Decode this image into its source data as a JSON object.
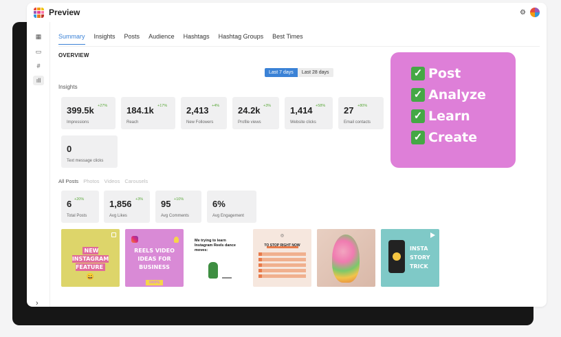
{
  "app": {
    "title": "Preview"
  },
  "tabs": [
    "Summary",
    "Insights",
    "Posts",
    "Audience",
    "Hashtags",
    "Hashtag Groups",
    "Best Times"
  ],
  "overview": {
    "heading": "OVERVIEW"
  },
  "date_range": {
    "active": "Last 7 days",
    "other": "Last 28 days"
  },
  "insights": {
    "heading": "Insights",
    "stats": [
      {
        "value": "399.5k",
        "change": "+27%",
        "label": "Impressions"
      },
      {
        "value": "184.1k",
        "change": "+17%",
        "label": "Reach"
      },
      {
        "value": "2,413",
        "change": "+4%",
        "label": "New Followers"
      },
      {
        "value": "24.2k",
        "change": "+3%",
        "label": "Profile views"
      },
      {
        "value": "1,414",
        "change": "+58%",
        "label": "Website clicks"
      },
      {
        "value": "27",
        "change": "+80%",
        "label": "Email contacts"
      },
      {
        "value": "0",
        "change": "",
        "label": "Text message clicks"
      }
    ]
  },
  "post_filters": [
    "All Posts",
    "Photos",
    "Videos",
    "Carousels"
  ],
  "post_stats": [
    {
      "value": "6",
      "change": "+20%",
      "label": "Total Posts"
    },
    {
      "value": "1,856",
      "change": "+3%",
      "label": "Avg Likes"
    },
    {
      "value": "95",
      "change": "+10%",
      "label": "Avg Comments"
    },
    {
      "value": "6%",
      "change": "",
      "label": "Avg Engagement"
    }
  ],
  "thumbnails": {
    "t1": {
      "text": "NEW INSTAGRAM FEATURE"
    },
    "t2": {
      "text": "REELS VIDEO IDEAS FOR BUSINESS",
      "tag": "SWIPE"
    },
    "t3": {
      "text": "Me trying to learn Instagram Reels dance moves:"
    },
    "t4": {
      "text": "TO STOP RIGHT NOW"
    },
    "t6": {
      "text": "INSTA STORY TRICK"
    }
  },
  "promo": {
    "items": [
      "Post",
      "Analyze",
      "Learn",
      "Create"
    ],
    "check_glyph": "✓"
  },
  "colors": {
    "accent": "#3b82d6",
    "positive": "#5aa83a",
    "promo_bg": "#de7fd8",
    "check": "#45a845"
  }
}
